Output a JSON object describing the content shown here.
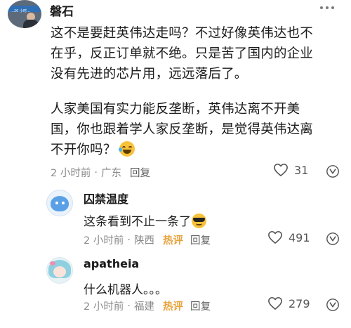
{
  "main_comment": {
    "username": "磐石",
    "avatar_banner_text": "…20 小时…",
    "lines": [
      "这不是要赶英伟达走吗？不过好像英伟达也不",
      "在乎，反正订单就不绝。只是苦了国内的企业",
      "没有先进的芯片用，远远落后了。",
      "人家美国有实力能反垄断，英伟达离不开美",
      "国，你也跟着学人家反垄断，是觉得英伟达离",
      "不开你吗？"
    ],
    "emoji": "laughing-with-tears",
    "time": "2 小时前",
    "separator": "·",
    "location": "广东",
    "reply_label": "回复",
    "likes": "31"
  },
  "replies": [
    {
      "username": "囚禁温度",
      "text": "这条看到不止一条了",
      "emoji": "sunglasses",
      "time": "2 小时前",
      "separator": "·",
      "location": "陕西",
      "hot_label": "热评",
      "reply_label": "回复",
      "likes": "491"
    },
    {
      "username": "apatheia",
      "text": "什么机器人。。。",
      "time": "2 小时前",
      "separator": "·",
      "location": "福建",
      "hot_label": "热评",
      "reply_label": "回复",
      "likes": "279"
    }
  ],
  "colors": {
    "meta_gray": "#8a8a8a",
    "hot_orange": "#e6a23c",
    "text": "#1a1a1a"
  }
}
